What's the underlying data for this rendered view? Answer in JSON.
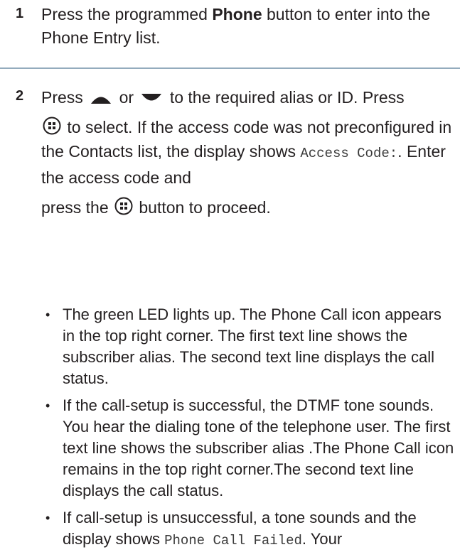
{
  "step1": {
    "number": "1",
    "text_before": "Press the programmed ",
    "bold": "Phone",
    "text_after": " button to enter into the Phone Entry list."
  },
  "step2": {
    "number": "2",
    "press": "Press",
    "or": "or",
    "after_arrows": "to the required alias or ID. Press",
    "select_text": "to select. If the access code was not preconfigured in the Contacts list, the display shows ",
    "access_code": "Access Code:",
    "after_access": ". Enter the access code and",
    "press_the": "press the",
    "proceed": "button to proceed.",
    "icons": {
      "up": "up-arrow-icon",
      "down": "down-arrow-icon",
      "ok": "menu-ok-icon"
    }
  },
  "bullets": [
    "The green LED lights up. The Phone Call icon appears in the top right corner. The first text line shows the subscriber alias. The second text line displays the call status.",
    "If the call-setup is successful, the DTMF tone sounds. You hear the dialing tone of the telephone user. The first text line shows the subscriber alias .The Phone Call icon remains in the top right corner.The second text line displays the call status."
  ],
  "bullet3": {
    "text_before": "If call-setup is unsuccessful, a tone sounds and the display shows ",
    "code": "Phone Call Failed",
    "text_after": ". Your"
  },
  "colors": {
    "text": "#231f20",
    "divider": "#93abbd"
  }
}
